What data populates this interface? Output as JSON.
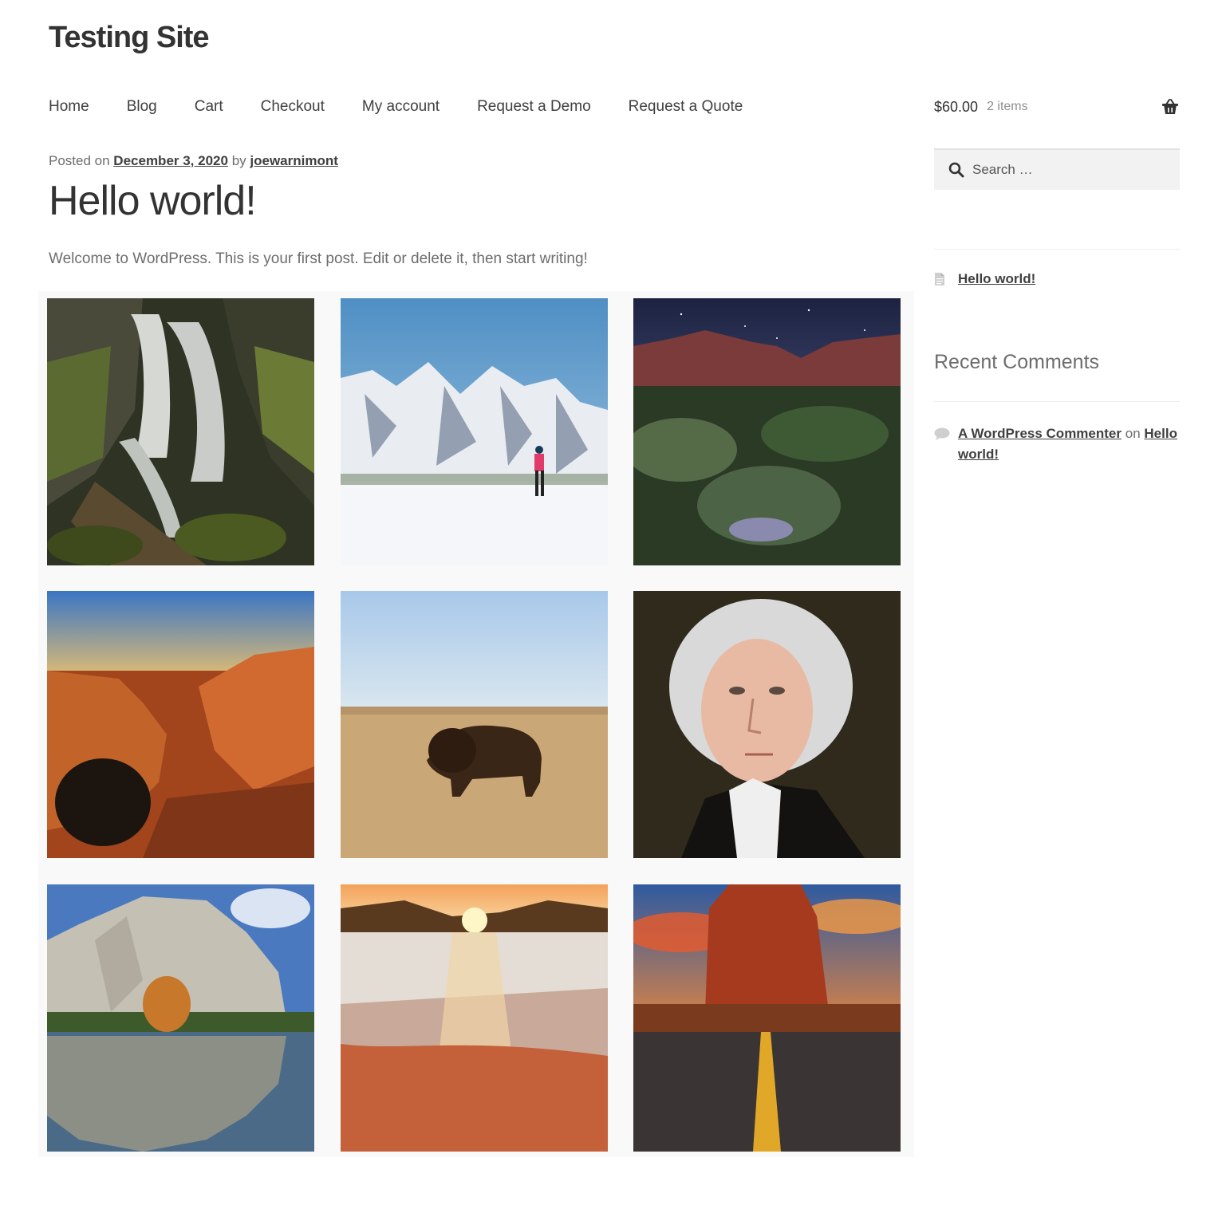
{
  "site": {
    "title": "Testing Site"
  },
  "nav": {
    "items": [
      "Home",
      "Blog",
      "Cart",
      "Checkout",
      "My account",
      "Request a Demo",
      "Request a Quote"
    ]
  },
  "cart": {
    "amount": "$60.00",
    "count": "2 items",
    "icon": "basket-icon"
  },
  "search": {
    "placeholder": "Search …",
    "icon": "search-icon"
  },
  "post": {
    "meta_prefix": "Posted on",
    "date": "December 3, 2020",
    "meta_by": "by",
    "author": "joewarnimont",
    "title": "Hello world!",
    "body": "Welcome to WordPress. This is your first post. Edit or delete it, then start writing!"
  },
  "gallery": {
    "images": [
      "waterfall",
      "skier-in-snowy-mountains",
      "desert-canyon-under-milky-way",
      "red-rock-arch",
      "bison-on-prairie",
      "george-washington-portrait",
      "el-capitan-reflection",
      "sunset-over-thermal-flats",
      "red-rock-tower-road"
    ]
  },
  "sidebar": {
    "recent_post": "Hello world!",
    "recent_comments_title": "Recent Comments",
    "comment_author": "A WordPress Commenter",
    "comment_on": "on",
    "comment_post": "Hello world!"
  },
  "colors": {
    "text": "#6d6d6d",
    "heading": "#333333",
    "link": "#404040",
    "gallery_bg": "#f9f9f9"
  }
}
